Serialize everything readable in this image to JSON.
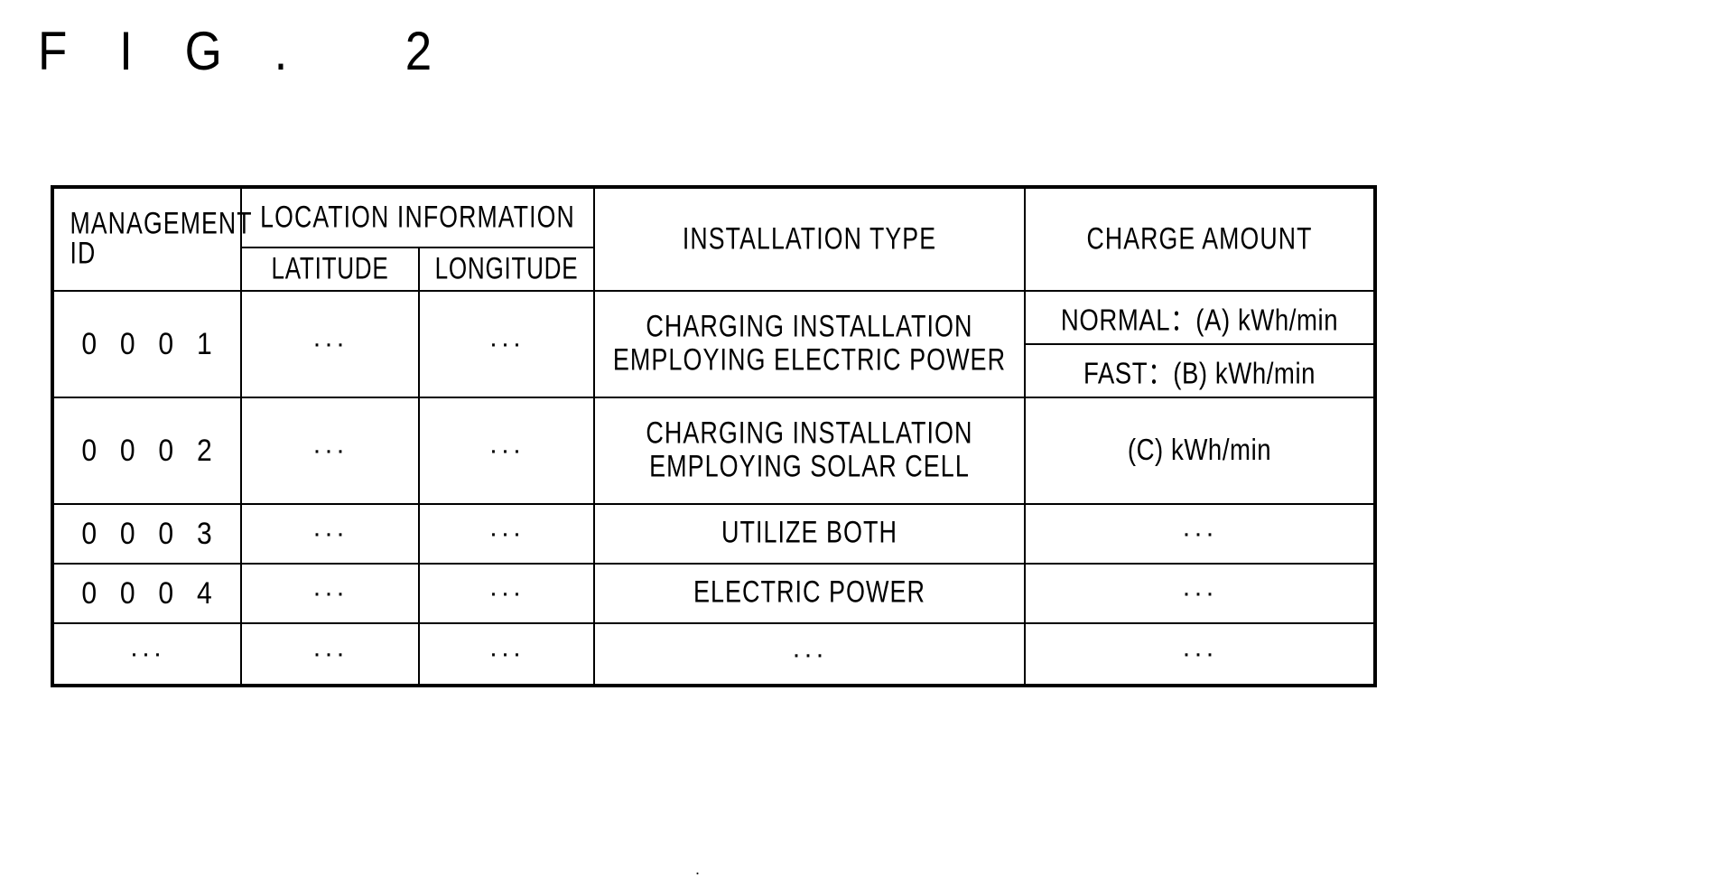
{
  "figure": {
    "label": "F I G .   2"
  },
  "table": {
    "headers": {
      "management_id": "MANAGEMENT\nID",
      "management_id_line1": "MANAGEMENT",
      "management_id_line2": "ID",
      "location_information": "LOCATION  INFORMATION",
      "latitude": "LATITUDE",
      "longitude": "LONGITUDE",
      "installation_type": "INSTALLATION  TYPE",
      "charge_amount": "CHARGE  AMOUNT"
    },
    "rows": [
      {
        "id": "0 0 0 1",
        "latitude": "···",
        "longitude": "···",
        "installation_type_line1": "CHARGING  INSTALLATION",
        "installation_type_line2": "EMPLOYING ELECTRIC POWER",
        "charge_amount_split": true,
        "charge_normal": "NORMAL：(A) kWh/min",
        "charge_fast": "FAST：(B) kWh/min"
      },
      {
        "id": "0 0 0 2",
        "latitude": "···",
        "longitude": "···",
        "installation_type_line1": "CHARGING  INSTALLATION",
        "installation_type_line2": "EMPLOYING SOLAR CELL",
        "charge_amount_split": false,
        "charge_amount": "(C) kWh/min"
      },
      {
        "id": "0 0 0 3",
        "latitude": "···",
        "longitude": "···",
        "installation_type": "UTILIZE BOTH",
        "charge_amount_split": false,
        "charge_amount": "···"
      },
      {
        "id": "0 0 0 4",
        "latitude": "···",
        "longitude": "···",
        "installation_type": "ELECTRIC POWER",
        "charge_amount_split": false,
        "charge_amount": "···"
      },
      {
        "id": "···",
        "latitude": "···",
        "longitude": "···",
        "installation_type": "···",
        "charge_amount_split": false,
        "charge_amount": "···"
      }
    ]
  },
  "page_mark": "."
}
